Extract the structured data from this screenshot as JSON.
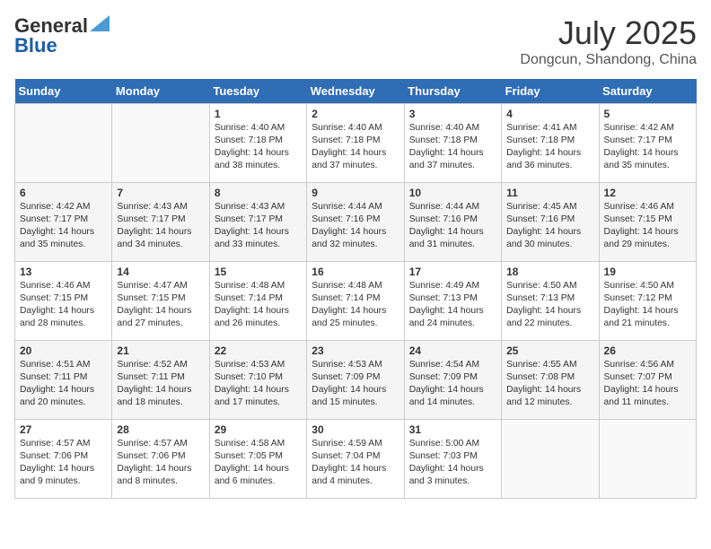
{
  "header": {
    "logo_general": "General",
    "logo_blue": "Blue",
    "month": "July 2025",
    "location": "Dongcun, Shandong, China"
  },
  "days_of_week": [
    "Sunday",
    "Monday",
    "Tuesday",
    "Wednesday",
    "Thursday",
    "Friday",
    "Saturday"
  ],
  "weeks": [
    [
      {
        "day": "",
        "content": ""
      },
      {
        "day": "",
        "content": ""
      },
      {
        "day": "1",
        "content": "Sunrise: 4:40 AM\nSunset: 7:18 PM\nDaylight: 14 hours\nand 38 minutes."
      },
      {
        "day": "2",
        "content": "Sunrise: 4:40 AM\nSunset: 7:18 PM\nDaylight: 14 hours\nand 37 minutes."
      },
      {
        "day": "3",
        "content": "Sunrise: 4:40 AM\nSunset: 7:18 PM\nDaylight: 14 hours\nand 37 minutes."
      },
      {
        "day": "4",
        "content": "Sunrise: 4:41 AM\nSunset: 7:18 PM\nDaylight: 14 hours\nand 36 minutes."
      },
      {
        "day": "5",
        "content": "Sunrise: 4:42 AM\nSunset: 7:17 PM\nDaylight: 14 hours\nand 35 minutes."
      }
    ],
    [
      {
        "day": "6",
        "content": "Sunrise: 4:42 AM\nSunset: 7:17 PM\nDaylight: 14 hours\nand 35 minutes."
      },
      {
        "day": "7",
        "content": "Sunrise: 4:43 AM\nSunset: 7:17 PM\nDaylight: 14 hours\nand 34 minutes."
      },
      {
        "day": "8",
        "content": "Sunrise: 4:43 AM\nSunset: 7:17 PM\nDaylight: 14 hours\nand 33 minutes."
      },
      {
        "day": "9",
        "content": "Sunrise: 4:44 AM\nSunset: 7:16 PM\nDaylight: 14 hours\nand 32 minutes."
      },
      {
        "day": "10",
        "content": "Sunrise: 4:44 AM\nSunset: 7:16 PM\nDaylight: 14 hours\nand 31 minutes."
      },
      {
        "day": "11",
        "content": "Sunrise: 4:45 AM\nSunset: 7:16 PM\nDaylight: 14 hours\nand 30 minutes."
      },
      {
        "day": "12",
        "content": "Sunrise: 4:46 AM\nSunset: 7:15 PM\nDaylight: 14 hours\nand 29 minutes."
      }
    ],
    [
      {
        "day": "13",
        "content": "Sunrise: 4:46 AM\nSunset: 7:15 PM\nDaylight: 14 hours\nand 28 minutes."
      },
      {
        "day": "14",
        "content": "Sunrise: 4:47 AM\nSunset: 7:15 PM\nDaylight: 14 hours\nand 27 minutes."
      },
      {
        "day": "15",
        "content": "Sunrise: 4:48 AM\nSunset: 7:14 PM\nDaylight: 14 hours\nand 26 minutes."
      },
      {
        "day": "16",
        "content": "Sunrise: 4:48 AM\nSunset: 7:14 PM\nDaylight: 14 hours\nand 25 minutes."
      },
      {
        "day": "17",
        "content": "Sunrise: 4:49 AM\nSunset: 7:13 PM\nDaylight: 14 hours\nand 24 minutes."
      },
      {
        "day": "18",
        "content": "Sunrise: 4:50 AM\nSunset: 7:13 PM\nDaylight: 14 hours\nand 22 minutes."
      },
      {
        "day": "19",
        "content": "Sunrise: 4:50 AM\nSunset: 7:12 PM\nDaylight: 14 hours\nand 21 minutes."
      }
    ],
    [
      {
        "day": "20",
        "content": "Sunrise: 4:51 AM\nSunset: 7:11 PM\nDaylight: 14 hours\nand 20 minutes."
      },
      {
        "day": "21",
        "content": "Sunrise: 4:52 AM\nSunset: 7:11 PM\nDaylight: 14 hours\nand 18 minutes."
      },
      {
        "day": "22",
        "content": "Sunrise: 4:53 AM\nSunset: 7:10 PM\nDaylight: 14 hours\nand 17 minutes."
      },
      {
        "day": "23",
        "content": "Sunrise: 4:53 AM\nSunset: 7:09 PM\nDaylight: 14 hours\nand 15 minutes."
      },
      {
        "day": "24",
        "content": "Sunrise: 4:54 AM\nSunset: 7:09 PM\nDaylight: 14 hours\nand 14 minutes."
      },
      {
        "day": "25",
        "content": "Sunrise: 4:55 AM\nSunset: 7:08 PM\nDaylight: 14 hours\nand 12 minutes."
      },
      {
        "day": "26",
        "content": "Sunrise: 4:56 AM\nSunset: 7:07 PM\nDaylight: 14 hours\nand 11 minutes."
      }
    ],
    [
      {
        "day": "27",
        "content": "Sunrise: 4:57 AM\nSunset: 7:06 PM\nDaylight: 14 hours\nand 9 minutes."
      },
      {
        "day": "28",
        "content": "Sunrise: 4:57 AM\nSunset: 7:06 PM\nDaylight: 14 hours\nand 8 minutes."
      },
      {
        "day": "29",
        "content": "Sunrise: 4:58 AM\nSunset: 7:05 PM\nDaylight: 14 hours\nand 6 minutes."
      },
      {
        "day": "30",
        "content": "Sunrise: 4:59 AM\nSunset: 7:04 PM\nDaylight: 14 hours\nand 4 minutes."
      },
      {
        "day": "31",
        "content": "Sunrise: 5:00 AM\nSunset: 7:03 PM\nDaylight: 14 hours\nand 3 minutes."
      },
      {
        "day": "",
        "content": ""
      },
      {
        "day": "",
        "content": ""
      }
    ]
  ]
}
